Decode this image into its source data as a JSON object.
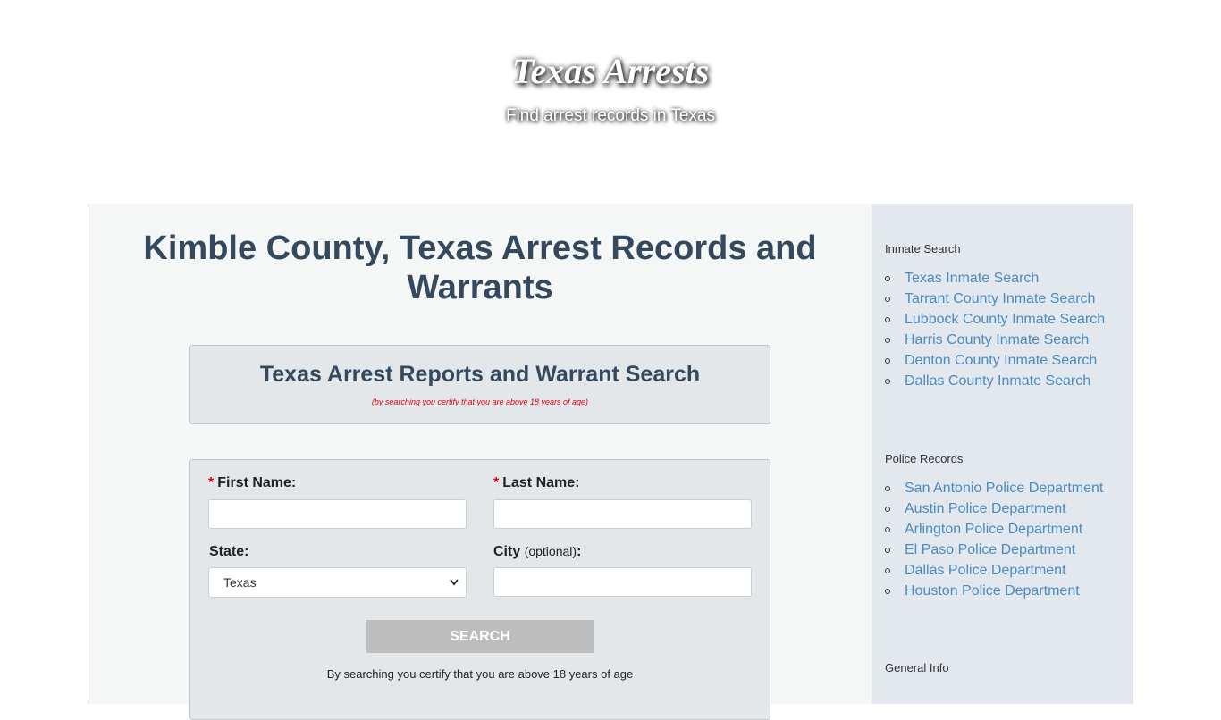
{
  "header": {
    "site_title": "Texas Arrests",
    "tagline": "Find arrest records in Texas"
  },
  "main": {
    "page_title": "Kimble County, Texas Arrest Records and Warrants",
    "search_box": {
      "title": "Texas Arrest Reports and Warrant Search",
      "certify_small": "(by searching you certify that you are above 18 years of age)"
    },
    "form": {
      "required_mark": "*",
      "first_name_label": "First Name:",
      "last_name_label": "Last Name:",
      "state_label": "State:",
      "state_value": "Texas",
      "city_label": "City",
      "city_optional": "(optional)",
      "city_colon": ":",
      "search_button": "SEARCH",
      "certify_note": "By searching you certify that you are above 18 years of age"
    }
  },
  "sidebar": {
    "inmate_search": {
      "title": "Inmate Search",
      "items": [
        "Texas Inmate Search",
        "Tarrant County Inmate Search",
        "Lubbock County Inmate Search",
        "Harris County Inmate Search",
        "Denton County Inmate Search",
        "Dallas County Inmate Search"
      ]
    },
    "police_records": {
      "title": "Police Records",
      "items": [
        "San Antonio Police Department",
        "Austin Police Department",
        "Arlington Police Department",
        "El Paso Police Department",
        "Dallas Police Department",
        "Houston Police Department"
      ]
    },
    "general_info": {
      "title": "General Info"
    }
  },
  "colors": {
    "title_text": "#34495e",
    "link": "#4a8bc2",
    "required": "#e3000f",
    "button": "#bdbdbd",
    "sidebar_bg": "#e3e7ee",
    "main_bg": "#f5f7f7"
  }
}
